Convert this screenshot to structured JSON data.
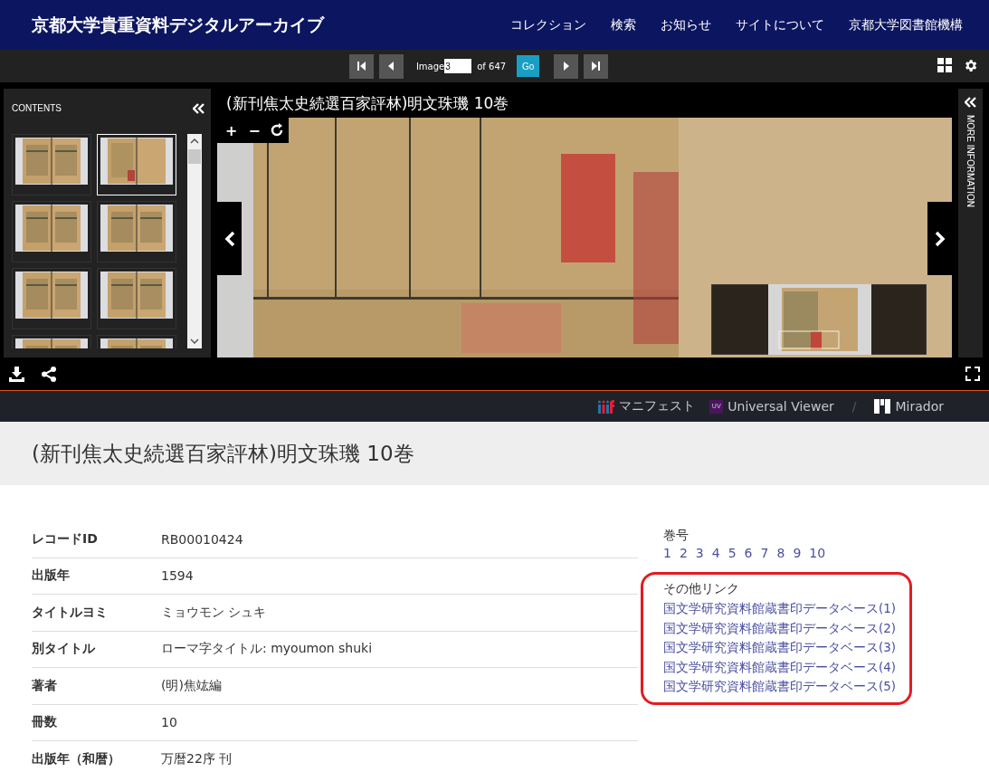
{
  "header": {
    "site_title": "京都大学貴重資料デジタルアーカイブ",
    "nav": [
      "コレクション",
      "検索",
      "お知らせ",
      "サイトについて",
      "京都大学図書館機構"
    ]
  },
  "toolbar": {
    "image_label": "Image",
    "image_value": "3",
    "of_label": "of 647",
    "go": "Go"
  },
  "contents_panel": {
    "title": "CONTENTS",
    "thumbnails": [
      {
        "selected": false
      },
      {
        "selected": true
      },
      {
        "selected": false
      },
      {
        "selected": false
      },
      {
        "selected": false
      },
      {
        "selected": false
      },
      {
        "selected": false
      },
      {
        "selected": false
      }
    ]
  },
  "viewer": {
    "title": "(新刊焦太史続選百家評林)明文珠璣 10巻",
    "zoom_controls": [
      "+",
      "−"
    ],
    "more_information": "MORE INFORMATION"
  },
  "viewer_links": [
    {
      "kind": "iiif",
      "label": "マニフェスト"
    },
    {
      "kind": "uv",
      "label": "Universal Viewer",
      "icon_text": "UV"
    },
    {
      "kind": "separator",
      "label": "/"
    },
    {
      "kind": "mirador",
      "label": "Mirador"
    }
  ],
  "page_title": "(新刊焦太史続選百家評林)明文珠璣 10巻",
  "metadata": [
    {
      "label": "レコードID",
      "value": "RB00010424"
    },
    {
      "label": "出版年",
      "value": "1594"
    },
    {
      "label": "タイトルヨミ",
      "value": "ミョウモン シュキ"
    },
    {
      "label": "別タイトル",
      "value": "ローマ字タイトル: myoumon shuki"
    },
    {
      "label": "著者",
      "value": "(明)焦竑編"
    },
    {
      "label": "冊数",
      "value": "10"
    },
    {
      "label": "出版年（和暦）",
      "value": "万暦22序 刊"
    }
  ],
  "volumes": {
    "title": "巻号",
    "items": [
      "1",
      "2",
      "3",
      "4",
      "5",
      "6",
      "7",
      "8",
      "9",
      "10"
    ]
  },
  "other_links": {
    "title": "その他リンク",
    "highlighted": true,
    "items": [
      "国文学研究資料館蔵書印データベース(1)",
      "国文学研究資料館蔵書印データベース(2)",
      "国文学研究資料館蔵書印データベース(3)",
      "国文学研究資料館蔵書印データベース(4)",
      "国文学研究資料館蔵書印データベース(5)"
    ]
  }
}
